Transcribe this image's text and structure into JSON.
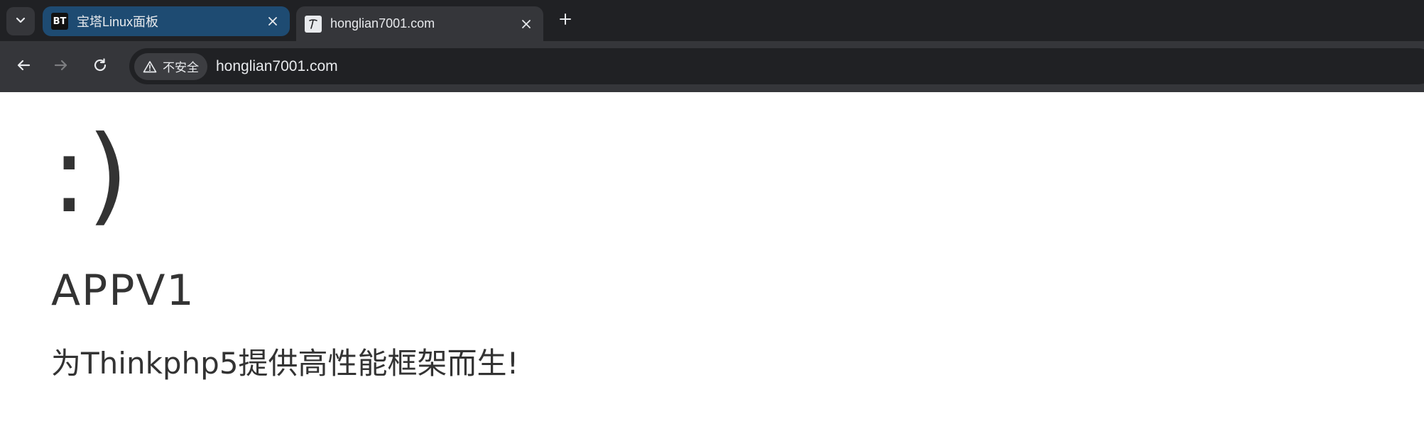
{
  "tabs": [
    {
      "title": "宝塔Linux面板",
      "favicon_text": "BT",
      "active": false,
      "color": "#1e4b72"
    },
    {
      "title": "honglian7001.com",
      "active": true,
      "color": "#35363a"
    }
  ],
  "toolbar": {
    "security_label": "不安全",
    "url": "honglian7001.com"
  },
  "page": {
    "emoticon": ":)",
    "app_name": "APPV1",
    "tagline": "为Thinkphp5提供高性能框架而生!"
  },
  "colors": {
    "chrome_bg": "#202124",
    "toolbar_bg": "#35363a",
    "page_text": "#333333",
    "page_bg": "#ffffff"
  }
}
